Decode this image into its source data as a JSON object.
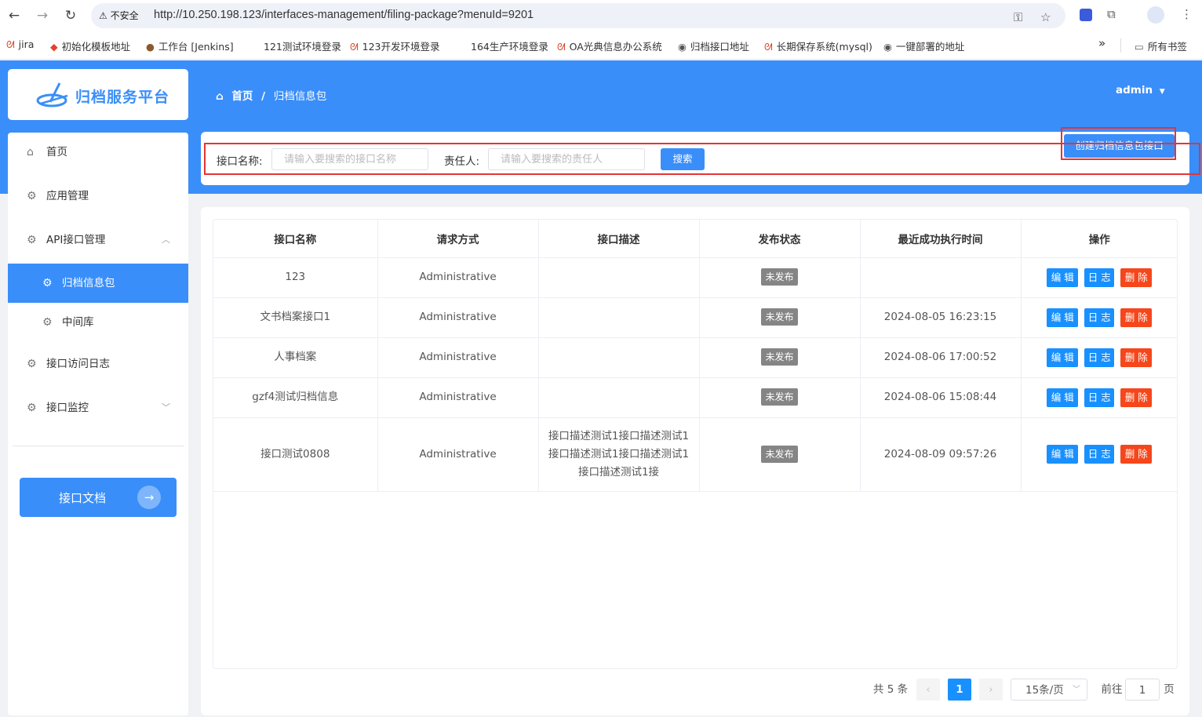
{
  "browser": {
    "insecure_label": "不安全",
    "url": "http://10.250.198.123/interfaces-management/filing-package?menuId=9201",
    "bookmarks": [
      "jira",
      "初始化模板地址",
      "工作台 [Jenkins]",
      "121测试环境登录",
      "123开发环境登录",
      "164生产环境登录",
      "OA光典信息办公系统",
      "归档接口地址",
      "长期保存系统(mysql)",
      "一键部署的地址"
    ],
    "more_label": "»",
    "all_bookmarks": "所有书签"
  },
  "app": {
    "logo_text": "归档服务平台",
    "breadcrumb": {
      "home": "首页",
      "separator": "/",
      "current": "归档信息包"
    },
    "user": "admin",
    "sidebar": {
      "items": [
        {
          "label": "首页"
        },
        {
          "label": "应用管理"
        },
        {
          "label": "API接口管理"
        },
        {
          "label": "归档信息包"
        },
        {
          "label": "中间库"
        },
        {
          "label": "接口访问日志"
        },
        {
          "label": "接口监控"
        }
      ],
      "doc_button": "接口文档"
    },
    "search": {
      "name_label": "接口名称:",
      "name_placeholder": "请输入要搜索的接口名称",
      "owner_label": "责任人:",
      "owner_placeholder": "请输入要搜索的责任人",
      "search_button": "搜索",
      "create_button": "创建归档信息包接口"
    },
    "table": {
      "headers": [
        "接口名称",
        "请求方式",
        "接口描述",
        "发布状态",
        "最近成功执行时间",
        "操作"
      ],
      "rows": [
        {
          "name": "123",
          "method": "Administrative",
          "desc": "",
          "status": "未发布",
          "time": ""
        },
        {
          "name": "文书档案接口1",
          "method": "Administrative",
          "desc": "",
          "status": "未发布",
          "time": "2024-08-05 16:23:15"
        },
        {
          "name": "人事档案",
          "method": "Administrative",
          "desc": "",
          "status": "未发布",
          "time": "2024-08-06 17:00:52"
        },
        {
          "name": "gzf4测试归档信息",
          "method": "Administrative",
          "desc": "",
          "status": "未发布",
          "time": "2024-08-06 15:08:44"
        },
        {
          "name": "接口测试0808",
          "method": "Administrative",
          "desc": "接口描述测试1接口描述测试1接口描述测试1接口描述测试1接口描述测试1接",
          "status": "未发布",
          "time": "2024-08-09 09:57:26"
        }
      ],
      "ops": {
        "edit": "编 辑",
        "log": "日 志",
        "delete": "删 除"
      }
    },
    "pagination": {
      "total": "共 5 条",
      "current_page": "1",
      "page_size": "15条/页",
      "goto_label": "前往",
      "goto_value": "1",
      "page_suffix": "页"
    }
  },
  "colors": {
    "primary": "#3a8ef9",
    "danger": "#f5471b",
    "highlight": "#e63434"
  }
}
